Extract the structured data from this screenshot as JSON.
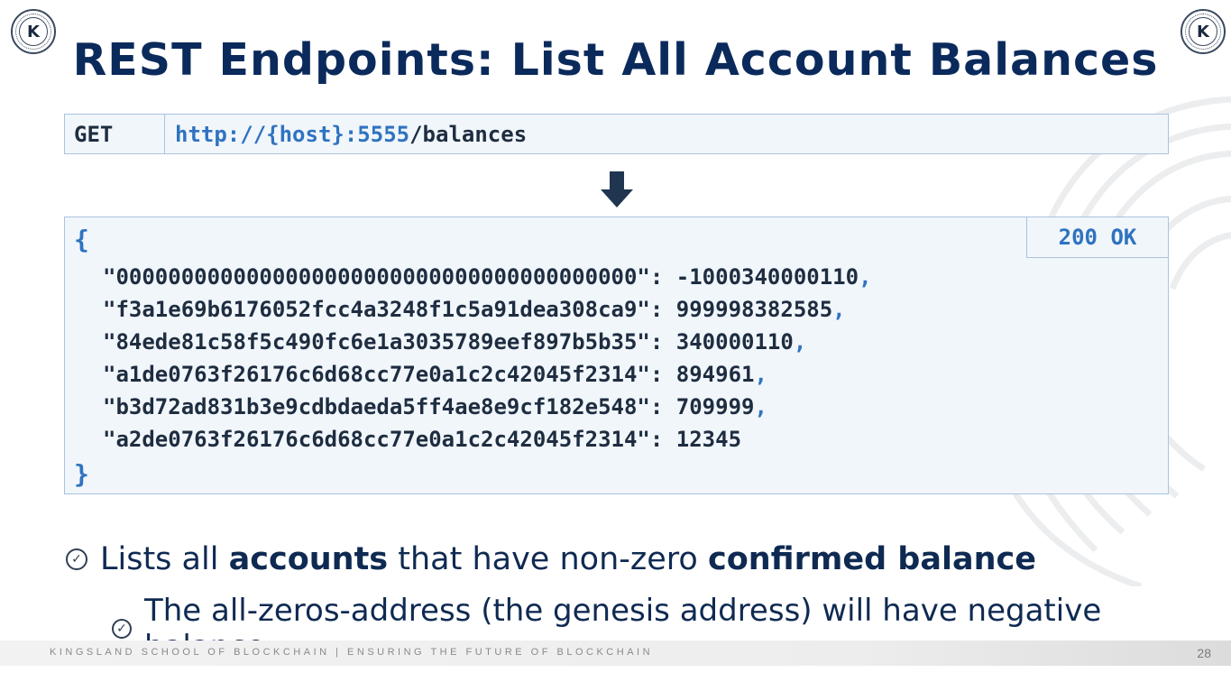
{
  "slide": {
    "logo_letter": "K",
    "title": "REST Endpoints: List All Account Balances"
  },
  "request": {
    "method": "GET",
    "url_prefix": "http://{host}:5555",
    "url_path": "/balances"
  },
  "response": {
    "status": "200 OK",
    "open_brace": "{",
    "close_brace": "}",
    "entries": [
      {
        "key": "\"0000000000000000000000000000000000000000\"",
        "sep": ": ",
        "value": "-1000340000110",
        "comma": ","
      },
      {
        "key": "\"f3a1e69b6176052fcc4a3248f1c5a91dea308ca9\"",
        "sep": ": ",
        "value": "999998382585",
        "comma": ","
      },
      {
        "key": "\"84ede81c58f5c490fc6e1a3035789eef897b5b35\"",
        "sep": ": ",
        "value": "340000110",
        "comma": ","
      },
      {
        "key": "\"a1de0763f26176c6d68cc77e0a1c2c42045f2314\"",
        "sep": ": ",
        "value": "894961",
        "comma": ","
      },
      {
        "key": "\"b3d72ad831b3e9cdbdaeda5ff4ae8e9cf182e548\"",
        "sep": ": ",
        "value": "709999",
        "comma": ","
      },
      {
        "key": "\"a2de0763f26176c6d68cc77e0a1c2c42045f2314\"",
        "sep": ": ",
        "value": "12345",
        "comma": ""
      }
    ]
  },
  "bullets": {
    "b1": {
      "pre": "Lists all ",
      "bold1": "accounts",
      "mid": " that have non-zero ",
      "bold2": "confirmed balance"
    },
    "b2": {
      "text": "The all-zeros-address (the genesis address) will have negative balance"
    }
  },
  "footer": {
    "text": "KINGSLAND SCHOOL OF BLOCKCHAIN | ENSURING THE FUTURE OF BLOCKCHAIN",
    "page_number": "28"
  },
  "icons": {
    "logo": "kingsland-logo-icon",
    "arrow": "arrow-down-icon",
    "check": "check-circle-icon"
  },
  "colors": {
    "title": "#0b2a5c",
    "accent_blue": "#2f73c0",
    "code_dark": "#1e2d40",
    "box_bg": "#f1f6fb",
    "box_border": "#a9c3df"
  }
}
